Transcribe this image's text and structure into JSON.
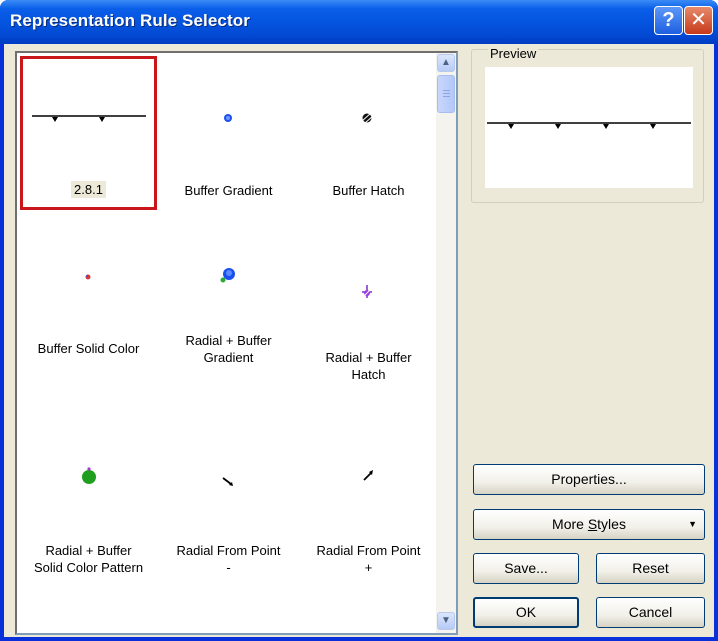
{
  "window": {
    "title": "Representation Rule Selector",
    "help_glyph": "?",
    "close_glyph": "✕"
  },
  "rules": [
    {
      "label": "2.8.1",
      "selected": true,
      "icon": "cartographic-line-with-triangles-icon"
    },
    {
      "label": "Buffer Gradient",
      "icon": "blue-dot-icon"
    },
    {
      "label": "Buffer Hatch",
      "icon": "hatched-dot-icon"
    },
    {
      "label": "Buffer Solid Color",
      "icon": "small-red-dot-icon"
    },
    {
      "label": "Radial + Buffer Gradient",
      "line1": "Radial + Buffer",
      "line2": "Gradient",
      "icon": "blue-green-dot-icon"
    },
    {
      "label": "Radial + Buffer Hatch",
      "line1": "Radial + Buffer",
      "line2": "Hatch",
      "icon": "purple-hatch-dot-icon"
    },
    {
      "label": "Radial + Buffer Solid Color Pattern",
      "line1": "Radial + Buffer",
      "line2": "Solid Color Pattern",
      "icon": "green-dot-icon"
    },
    {
      "label": "Radial From Point -",
      "line1": "Radial From Point",
      "line2": "-",
      "icon": "small-arrow-icon"
    },
    {
      "label": "Radial From Point +",
      "line1": "Radial From Point",
      "line2": "+",
      "icon": "small-arrow-up-icon"
    }
  ],
  "preview": {
    "label": "Preview"
  },
  "buttons": {
    "properties": "Properties...",
    "more_styles": "More Styles",
    "more_styles_mnemonic": "S",
    "save": "Save...",
    "reset": "Reset",
    "ok": "OK",
    "cancel": "Cancel"
  },
  "scrollbar": {
    "up_glyph": "▲",
    "down_glyph": "▼"
  },
  "colors": {
    "title_bar": "#0a5ee8",
    "selection_border": "#c8161b",
    "dialog_face": "#ece9d8"
  }
}
